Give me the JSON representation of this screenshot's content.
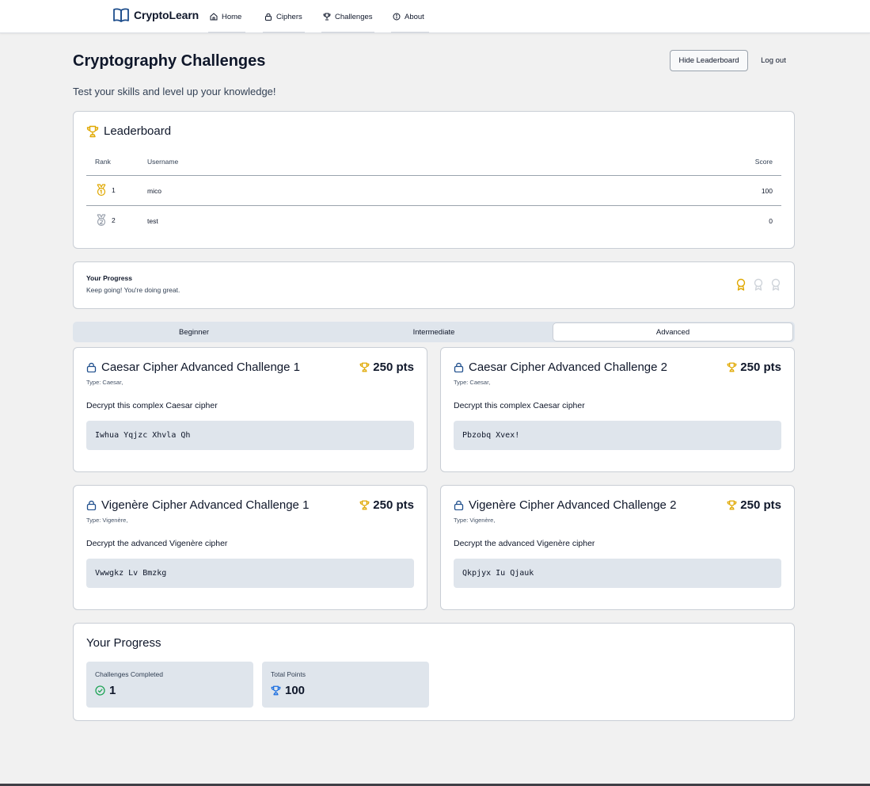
{
  "nav": {
    "brand": "CryptoLearn",
    "items": [
      {
        "label": "Home",
        "icon": "home-icon"
      },
      {
        "label": "Ciphers",
        "icon": "lock-icon"
      },
      {
        "label": "Challenges",
        "icon": "trophy-icon"
      },
      {
        "label": "About",
        "icon": "info-icon"
      }
    ]
  },
  "header": {
    "title": "Cryptography Challenges",
    "subtitle": "Test your skills and level up your knowledge!",
    "hide_leaderboard": "Hide Leaderboard",
    "logout": "Log out"
  },
  "leaderboard": {
    "title": "Leaderboard",
    "columns": {
      "rank": "Rank",
      "username": "Username",
      "score": "Score"
    },
    "rows": [
      {
        "rank": "1",
        "username": "mico",
        "score": "100",
        "medal": "gold"
      },
      {
        "rank": "2",
        "username": "test",
        "score": "0",
        "medal": "silver"
      }
    ]
  },
  "progress_banner": {
    "title": "Your Progress",
    "message": "Keep going! You're doing great.",
    "medals": [
      "earned",
      "locked",
      "locked"
    ]
  },
  "tabs": [
    {
      "label": "Beginner",
      "active": false
    },
    {
      "label": "Intermediate",
      "active": false
    },
    {
      "label": "Advanced",
      "active": true
    }
  ],
  "challenges": [
    {
      "title": "Caesar Cipher Advanced Challenge 1",
      "points": "250 pts",
      "type": "Type: Caesar,",
      "description": "Decrypt this complex Caesar cipher",
      "ciphertext": "Iwhua Yqjzc Xhvla Qh"
    },
    {
      "title": "Caesar Cipher Advanced Challenge 2",
      "points": "250 pts",
      "type": "Type: Caesar,",
      "description": "Decrypt this complex Caesar cipher",
      "ciphertext": "Pbzobq Xvex!"
    },
    {
      "title": "Vigenère Cipher Advanced Challenge 1",
      "points": "250 pts",
      "type": "Type: Vigenère,",
      "description": "Decrypt the advanced Vigenère cipher",
      "ciphertext": "Vwwgkz Lv Bmzkg"
    },
    {
      "title": "Vigenère Cipher Advanced Challenge 2",
      "points": "250 pts",
      "type": "Type: Vigenère,",
      "description": "Decrypt the advanced Vigenère cipher",
      "ciphertext": "Qkpjyx Iu Qjauk"
    }
  ],
  "your_progress": {
    "title": "Your Progress",
    "completed_label": "Challenges Completed",
    "completed_value": "1",
    "points_label": "Total Points",
    "points_value": "100"
  },
  "colors": {
    "brand_blue": "#1e4e8c",
    "gold": "#e0a800",
    "silver": "#9ca3af",
    "success": "#22a559",
    "accent_blue": "#1d6fe0"
  }
}
